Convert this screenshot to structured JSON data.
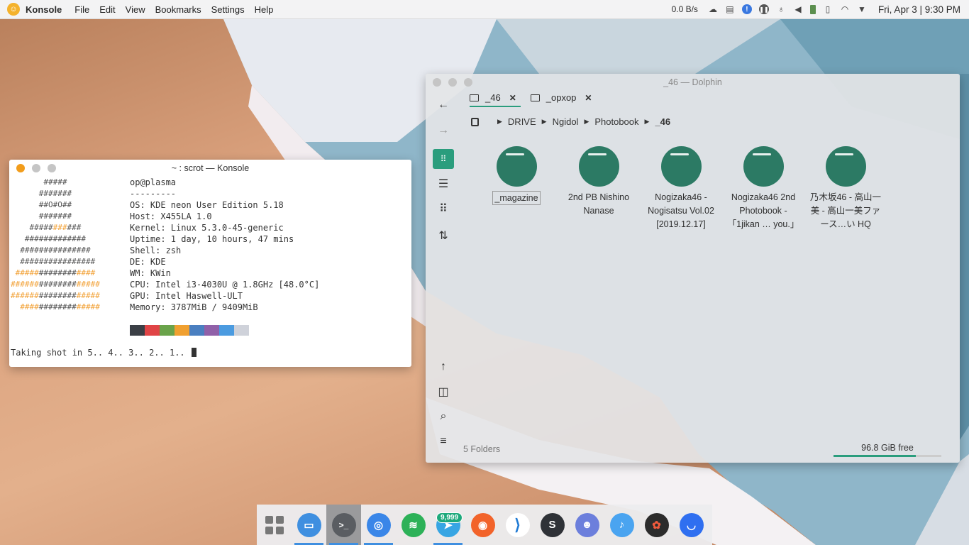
{
  "topbar": {
    "app_name": "Konsole",
    "menu": [
      "File",
      "Edit",
      "View",
      "Bookmarks",
      "Settings",
      "Help"
    ],
    "net_speed": "0.0 B/s",
    "clock": "Fri, Apr 3 | 9:30 PM",
    "tray_icons": [
      "cloud-icon",
      "clipboard-icon",
      "notification-icon",
      "media-pause-icon",
      "bulb-icon",
      "volume-icon",
      "battery-icon",
      "phone-icon",
      "wifi-icon",
      "expand-tray-icon"
    ]
  },
  "konsole": {
    "title": "~ : scrot — Konsole",
    "logo_lines": [
      "       #####",
      "      #######",
      "      ##O#O##",
      "      #######",
      "    ###########",
      "   #############",
      "  ###############",
      "  ################",
      " #################",
      "###################",
      "###################",
      "  #################"
    ],
    "info": [
      "op@plasma",
      "---------",
      "OS: KDE neon User Edition 5.18",
      "Host: X455LA 1.0",
      "Kernel: Linux 5.3.0-45-generic",
      "Uptime: 1 day, 10 hours, 47 mins",
      "Shell: zsh",
      "DE: KDE",
      "WM: KWin",
      "CPU: Intel i3-4030U @ 1.8GHz [48.0°C]",
      "GPU: Intel Haswell-ULT",
      "Memory: 3787MiB / 9409MiB"
    ],
    "palette": [
      "#3b3f46",
      "#e04446",
      "#6aa34a",
      "#f0a030",
      "#4a7fc0",
      "#9060a8",
      "#4b9be0",
      "#cfd2da"
    ],
    "prompt": "Taking shot in 5.. 4.. 3.. 2.. 1.."
  },
  "dolphin": {
    "title": "_46 — Dolphin",
    "tabs": [
      {
        "label": "_46",
        "active": true
      },
      {
        "label": "_opxop",
        "active": false
      }
    ],
    "breadcrumb": [
      "DRIVE",
      "Ngidol",
      "Photobook",
      "_46"
    ],
    "folders": [
      {
        "label": "_magazine"
      },
      {
        "label": "2nd PB Nishino Nanase"
      },
      {
        "label": "Nogizaka46 - Nogisatsu Vol.02 [2019.12.17]"
      },
      {
        "label": "Nogizaka46 2nd Photobook - 「1jikan … you.」"
      },
      {
        "label": "乃木坂46 - 高山一美 - 高山一美ファース…い HQ"
      }
    ],
    "status": "5 Folders",
    "free_space": "96.8 GiB free",
    "used_fraction": 0.76
  },
  "dock": {
    "apps": [
      "app-grid-icon",
      "dolphin-icon",
      "konsole-icon",
      "chromium-icon",
      "spotify-icon",
      "telegram-icon",
      "firefox-icon",
      "vscode-icon",
      "simplenote-icon",
      "discord-icon",
      "music-icon",
      "figma-icon",
      "mail-icon"
    ],
    "telegram_badge": "9,999"
  }
}
